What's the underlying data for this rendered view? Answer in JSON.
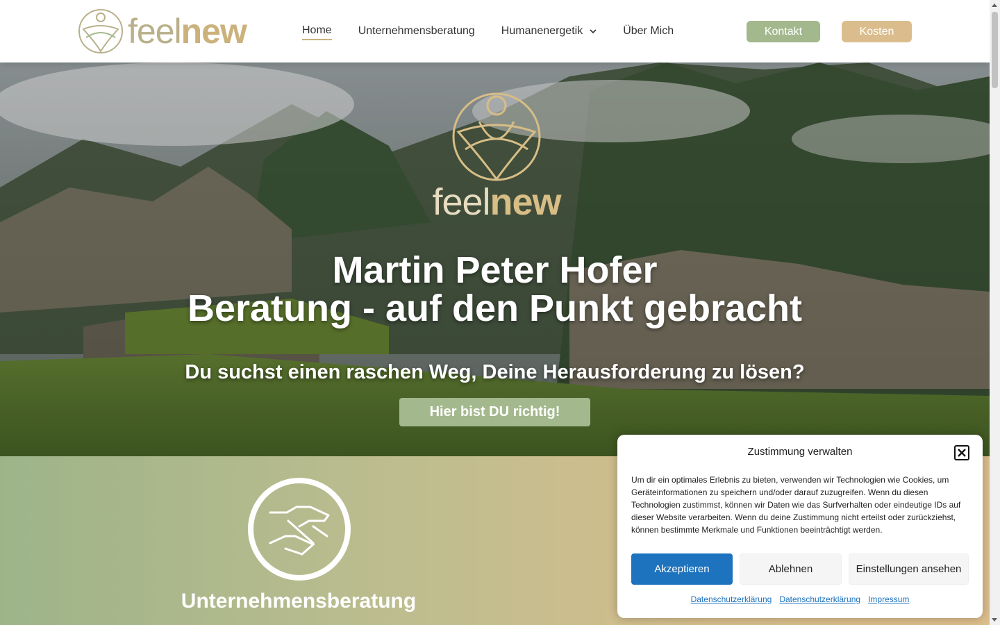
{
  "header": {
    "logo": {
      "feel": "feel",
      "new": "new"
    },
    "nav": [
      {
        "label": "Home",
        "active": true
      },
      {
        "label": "Unternehmensberatung"
      },
      {
        "label": "Humanenergetik",
        "has_dropdown": true
      },
      {
        "label": "Über Mich"
      }
    ],
    "kontakt_label": "Kontakt",
    "kosten_label": "Kosten"
  },
  "hero": {
    "logo": {
      "feel": "feel",
      "new": "new"
    },
    "title_line1": "Martin Peter Hofer",
    "title_line2": "Beratung - auf den Punkt gebracht",
    "subtitle": "Du suchst einen raschen Weg, Deine Herausforderung zu lösen?",
    "cta_label": "Hier bist DU richtig!"
  },
  "services": {
    "first": {
      "title": "Unternehmensberatung",
      "icon": "handshake-icon"
    }
  },
  "consent": {
    "title": "Zustimmung verwalten",
    "text": "Um dir ein optimales Erlebnis zu bieten, verwenden wir Technologien wie Cookies, um Geräteinformationen zu speichern und/oder darauf zuzugreifen. Wenn du diesen Technologien zustimmst, können wir Daten wie das Surfverhalten oder eindeutige IDs auf dieser Website verarbeiten. Wenn du deine Zustimmung nicht erteilst oder zurückziehst, können bestimmte Merkmale und Funktionen beeinträchtigt werden.",
    "accept_label": "Akzeptieren",
    "decline_label": "Ablehnen",
    "settings_label": "Einstellungen ansehen",
    "links": [
      "Datenschutzerklärung",
      "Datenschutzerklärung",
      "Impressum"
    ]
  },
  "colors": {
    "green": "#a3b98d",
    "gold": "#dbbd8d",
    "link_blue": "#1e73be"
  }
}
